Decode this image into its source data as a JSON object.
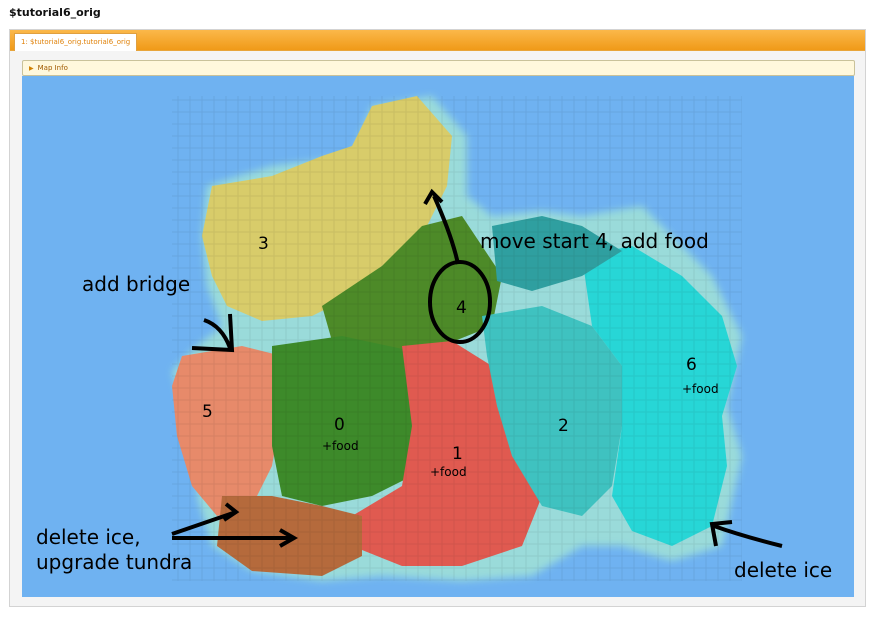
{
  "window_title": "$tutorial6_orig",
  "tab": {
    "label": "1: $tutorial6_orig.tutorial6_orig"
  },
  "map_info": {
    "label": "Map Info",
    "icon": "triangle-right-icon"
  },
  "annotations": {
    "move_start": "move start 4, add food",
    "add_bridge": "add bridge",
    "delete_ice_tundra": "delete ice,\nupgrade tundra",
    "delete_ice": "delete ice"
  },
  "players": [
    {
      "number": "0",
      "note": "+food"
    },
    {
      "number": "1",
      "note": "+food"
    },
    {
      "number": "2",
      "note": ""
    },
    {
      "number": "3",
      "note": ""
    },
    {
      "number": "4",
      "note": ""
    },
    {
      "number": "5",
      "note": ""
    },
    {
      "number": "6",
      "note": "+food"
    }
  ],
  "colors": {
    "ocean": "#6fb2f1",
    "tab_bar": "#f5a623",
    "territory_0": "#3d8a2a",
    "territory_1": "#e05a50",
    "territory_2": "#3fc2c0",
    "territory_3": "#d8cc6a",
    "territory_4": "#4d8a28",
    "territory_5": "#e78a6a",
    "territory_6": "#27d6d6"
  }
}
